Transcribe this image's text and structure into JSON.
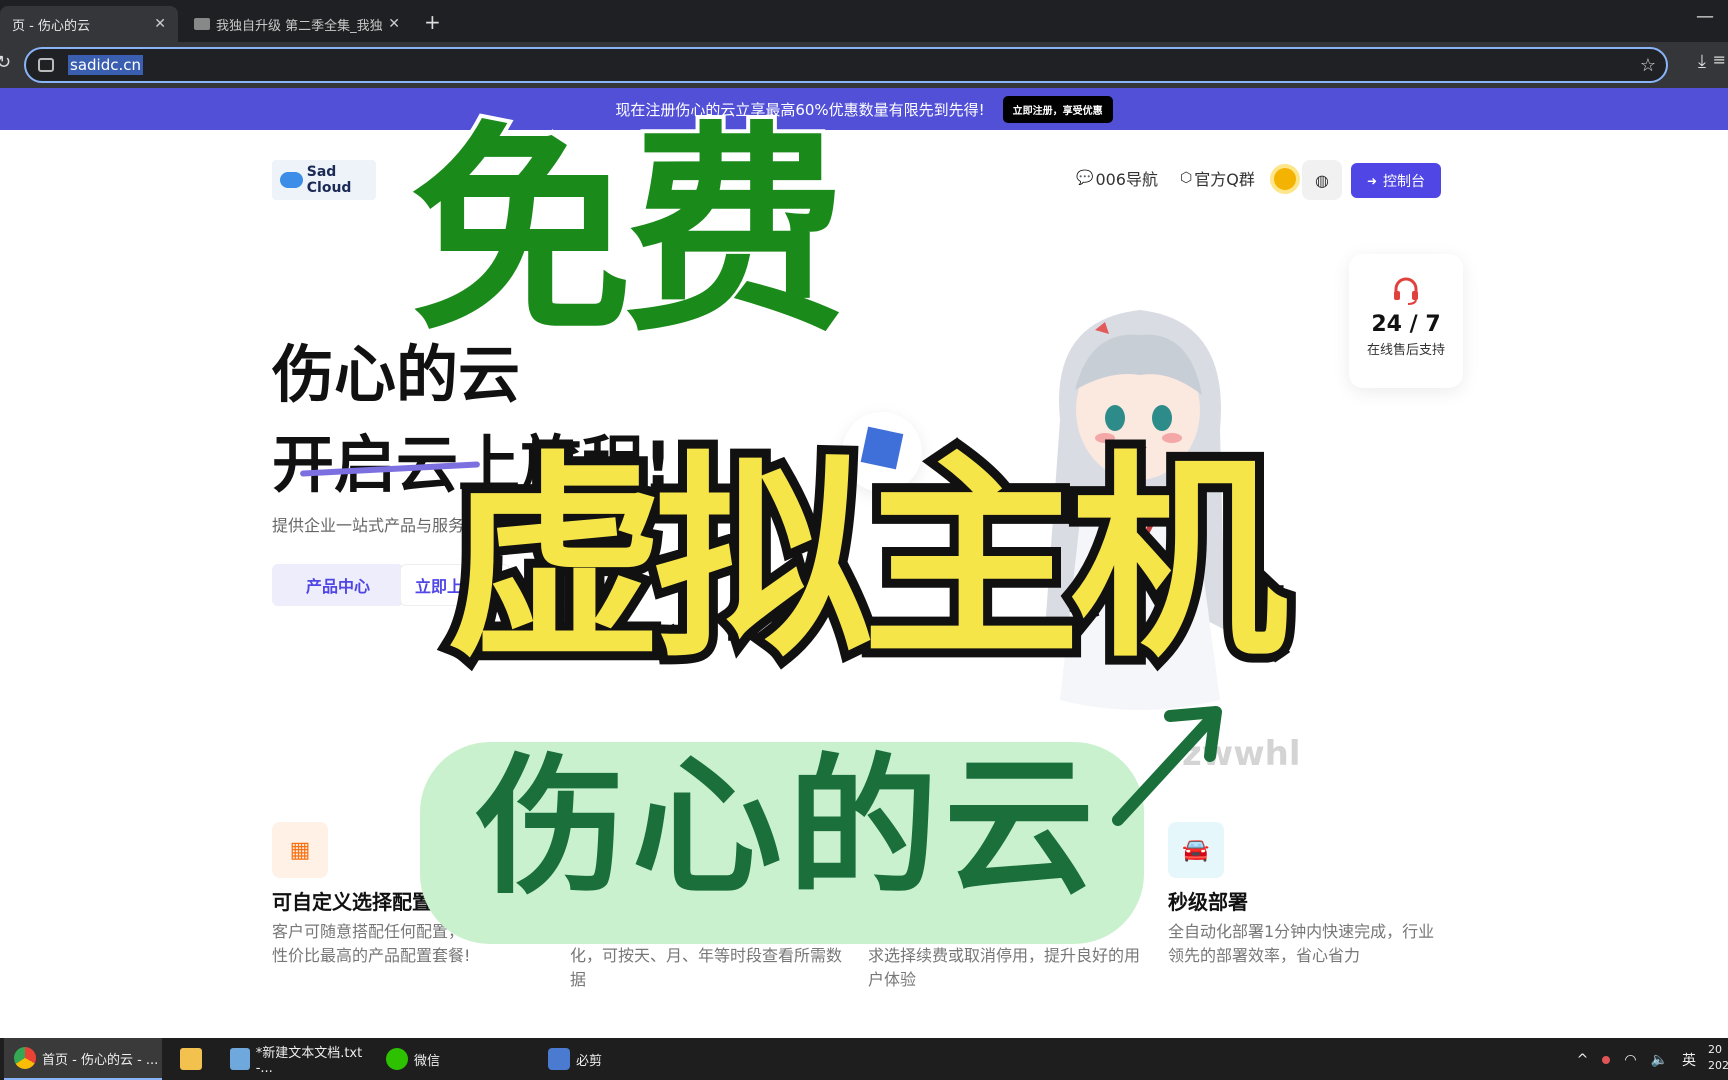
{
  "browser": {
    "tabs": [
      {
        "label": "页 - 伤心的云"
      },
      {
        "label": "我独自升级 第二季全集_我独自"
      }
    ],
    "new_tab": "+",
    "url": "sadidc.cn"
  },
  "promo": {
    "text": "现在注册伤心的云立享最高60%优惠数量有限先到先得!",
    "button": "立即注册，享受优惠"
  },
  "header": {
    "logo_text": "Sad Cloud",
    "nav": [
      {
        "label": "006导航",
        "icon": "chat-icon"
      },
      {
        "label": "官方Q群",
        "icon": "cube-icon"
      }
    ],
    "console_label": "控制台"
  },
  "hero": {
    "title_line1": "伤心的云",
    "title_line2": "开启云上旅程!",
    "subtitle": "提供企业一站式产品与服务",
    "btn_products": "产品中心",
    "btn_now": "立即上"
  },
  "support": {
    "number": "24 / 7",
    "label": "在线售后支持"
  },
  "watermark": "zwwhl",
  "features": [
    {
      "title": "可自定义选择配置",
      "desc": "客户可随意搭配任何配置，到性价比最高的产品配置套餐!",
      "icon": "building-icon",
      "color": "#f97316",
      "bg": "#fff1e6"
    },
    {
      "title": "",
      "desc": "化，可按天、月、年等时段查看所需数据",
      "icon": "",
      "color": "",
      "bg": ""
    },
    {
      "title": "",
      "desc": "求选择续费或取消停用，提升良好的用户体验",
      "icon": "",
      "color": "",
      "bg": ""
    },
    {
      "title": "秒级部署",
      "desc": "全自动化部署1分钟内快速完成，行业领先的部署效率，省心省力",
      "icon": "car-icon",
      "color": "#0ea5c6",
      "bg": "#e6f7fb"
    }
  ],
  "overlay": {
    "free": "免费",
    "virtual_host": "虚拟主机",
    "brand": "伤心的云"
  },
  "taskbar": {
    "items": [
      {
        "label": "首页 - 伤心的云 - ..."
      },
      {
        "label": ""
      },
      {
        "label": "*新建文本文档.txt -..."
      },
      {
        "label": "微信"
      },
      {
        "label": "必剪"
      }
    ],
    "ime": "英",
    "clock_line1": "20",
    "clock_line2": "202"
  },
  "colors": {
    "promo_bg": "#5250d7",
    "accent": "#4f46e5",
    "free_green": "#1a8a1a",
    "host_yellow": "#f6e548",
    "pill_green": "#c9f1cd",
    "brand_green": "#1a6f3b"
  }
}
